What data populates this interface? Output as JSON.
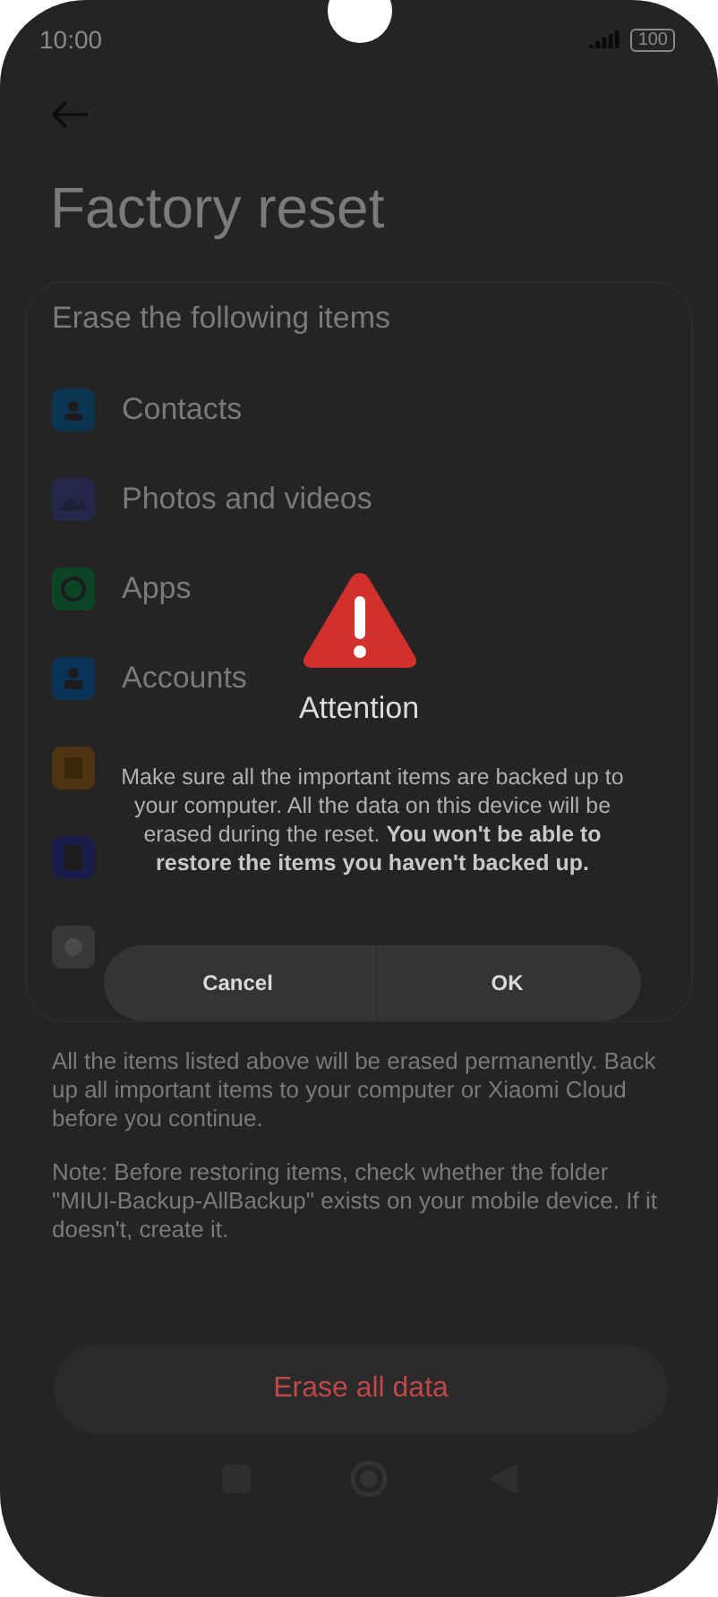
{
  "status_bar": {
    "time": "10:00",
    "battery": "100"
  },
  "title": "Factory reset",
  "card": {
    "heading": "Erase the following items",
    "items": [
      {
        "label": "Contacts",
        "kind": "contacts",
        "color": "#0b3552"
      },
      {
        "label": "Photos and videos",
        "kind": "photos",
        "color": "#26264a"
      },
      {
        "label": "Apps",
        "kind": "apps",
        "color": "#0c4526"
      },
      {
        "label": "Accounts",
        "kind": "accounts",
        "color": "#0b3358"
      },
      {
        "kind": "backups",
        "color": "#4e3410"
      },
      {
        "kind": "sd",
        "color": "#1c1c4a"
      },
      {
        "kind": "other",
        "color": "#383838"
      }
    ]
  },
  "notes": [
    "All the items listed above will be erased permanently. Back up all important items to your computer or Xiaomi Cloud before you continue.",
    "Note: Before restoring items, check whether the folder \"MIUI-Backup-AllBackup\" exists on your mobile device. If it doesn't, create it."
  ],
  "erase_button": "Erase all data",
  "dialog": {
    "title": "Attention",
    "message": "Make sure all the important items are backed up to your computer. All the data on this device will be erased during the reset. **You won't be able to restore the items you haven't backed up.**",
    "buttons": [
      "Cancel",
      "OK"
    ]
  }
}
